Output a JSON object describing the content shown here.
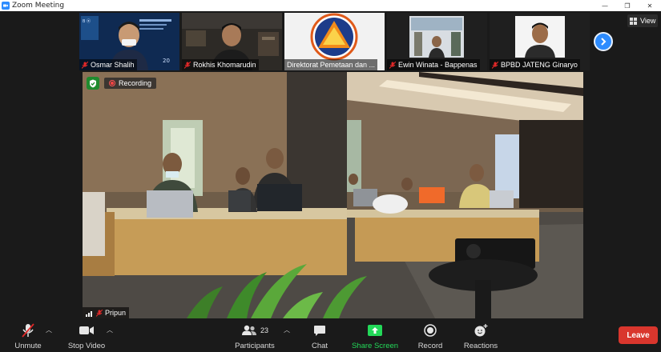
{
  "window": {
    "title": "Zoom Meeting",
    "controls": [
      "—",
      "❐",
      "✕"
    ]
  },
  "thumbnails": [
    {
      "name": "Osmar Shalih"
    },
    {
      "name": "Rokhis Khomarudin"
    },
    {
      "name": "Direktorat Pemetaan dan ..."
    },
    {
      "name": "Ewin Winata - Bappenas"
    },
    {
      "name": "BPBD JATENG  Ginaryo"
    }
  ],
  "view_button": {
    "label": "View"
  },
  "main_video": {
    "recording_label": "Recording",
    "speaker_name": "Pripun"
  },
  "toolbar": {
    "unmute": "Unmute",
    "stop_video": "Stop Video",
    "participants": "Participants",
    "participants_count": "23",
    "chat": "Chat",
    "share_screen": "Share Screen",
    "record": "Record",
    "reactions": "Reactions",
    "leave": "Leave"
  },
  "colors": {
    "accent": "#2d8cff",
    "share_green": "#23d959",
    "leave_red": "#d9362d",
    "muted_red": "#e02828"
  }
}
